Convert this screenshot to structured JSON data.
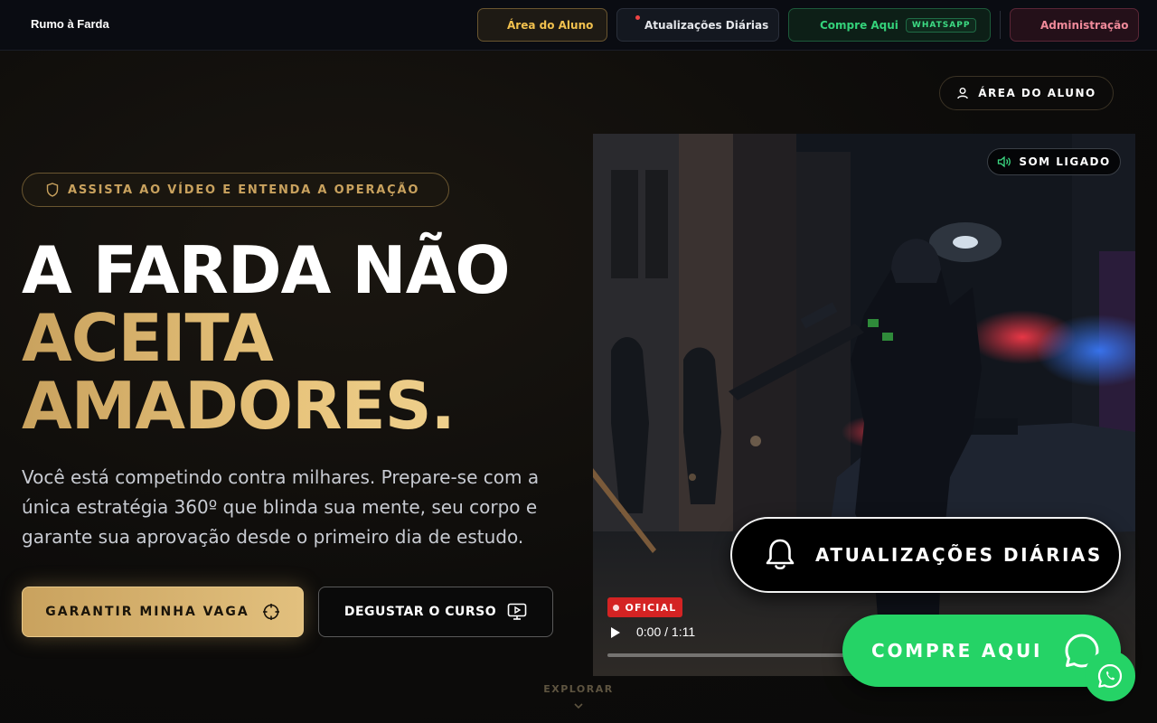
{
  "nav": {
    "brand": "Rumo à Farda",
    "items": [
      {
        "label": "Área do Aluno"
      },
      {
        "label": "Atualizações Diárias"
      },
      {
        "label": "Compre Aqui",
        "badge": "WHATSAPP"
      },
      {
        "label": "Administração"
      }
    ]
  },
  "hero": {
    "area_button": "ÁREA DO ALUNO",
    "tagline": "ASSISTA AO VÍDEO E ENTENDA A OPERAÇÃO",
    "headline_white": "A FARDA NÃO",
    "headline_gold_1": "ACEITA",
    "headline_gold_2": "AMADORES.",
    "subtext": "Você está competindo contra milhares. Prepare-se com a única estratégia 360º que blinda sua mente, seu corpo e garante sua aprovação desde o primeiro dia de estudo.",
    "primary_cta": "GARANTIR MINHA VAGA",
    "secondary_cta": "DEGUSTAR O CURSO",
    "explore": "EXPLORAR"
  },
  "video": {
    "sound_label": "SOM LIGADO",
    "badge": "OFICIAL",
    "time": "0:00 / 1:11",
    "progress": 0
  },
  "floating": {
    "updates": "ATUALIZAÇÕES DIÁRIAS",
    "buy": "COMPRE AQUI"
  },
  "colors": {
    "gold": "#c9a25e",
    "whatsapp_green": "#25d366",
    "badge_red": "#d42323"
  }
}
